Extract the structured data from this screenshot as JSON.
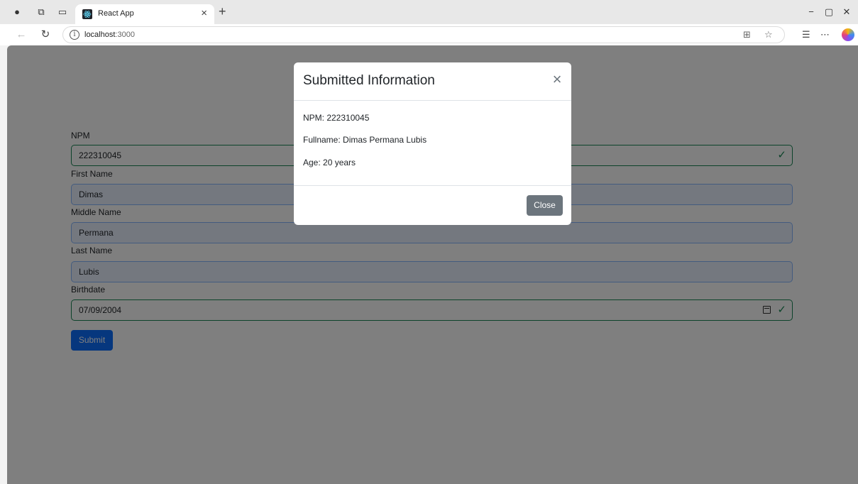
{
  "browser": {
    "tab_title": "React App",
    "tab_close": "×",
    "new_tab": "+",
    "url_host": "localhost",
    "url_port": ":3000",
    "window_controls": {
      "minimize": "−",
      "restore": "▢",
      "close": "✕"
    }
  },
  "form": {
    "fields": [
      {
        "label": "NPM",
        "value": "222310045",
        "valid": true
      },
      {
        "label": "First Name",
        "value": "Dimas",
        "valid": false
      },
      {
        "label": "Middle Name",
        "value": "Permana",
        "valid": false
      },
      {
        "label": "Last Name",
        "value": "Lubis",
        "valid": false
      },
      {
        "label": "Birthdate",
        "value": "07/09/2004",
        "valid": true
      }
    ],
    "submit_label": "Submit"
  },
  "modal": {
    "title": "Submitted Information",
    "close_x": "×",
    "lines": [
      "NPM: 222310045",
      "Fullname: Dimas Permana Lubis",
      "Age: 20 years"
    ],
    "close_label": "Close"
  },
  "colors": {
    "primary": "#0d6efd",
    "secondary": "#6c757d",
    "success": "#198754",
    "autofill_bg": "#e8f0fe"
  }
}
